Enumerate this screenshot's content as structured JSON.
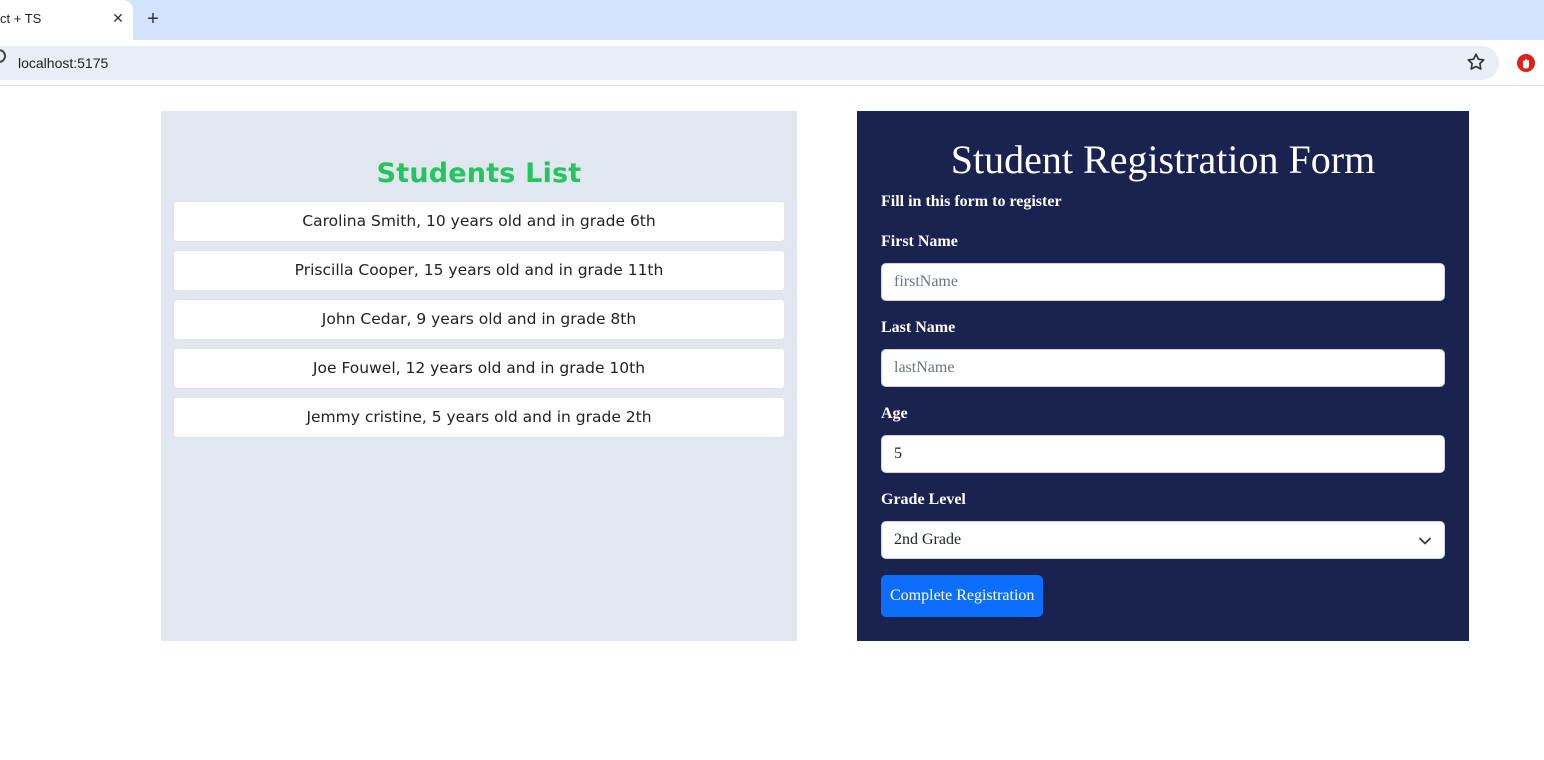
{
  "browser": {
    "tab_title": "ct + TS",
    "url": "localhost:5175"
  },
  "students": {
    "title": "Students List",
    "items": [
      "Carolina Smith, 10 years old and in grade 6th",
      "Priscilla Cooper, 15 years old and in grade 11th",
      "John Cedar, 9 years old and in grade 8th",
      "Joe Fouwel, 12 years old and in grade 10th",
      "Jemmy cristine, 5 years old and in grade 2th"
    ]
  },
  "form": {
    "title": "Student Registration Form",
    "subtitle": "Fill in this form to register",
    "first_name": {
      "label": "First Name",
      "placeholder": "firstName",
      "value": ""
    },
    "last_name": {
      "label": "Last Name",
      "placeholder": "lastName",
      "value": ""
    },
    "age": {
      "label": "Age",
      "value": "5"
    },
    "grade": {
      "label": "Grade Level",
      "selected": "2nd Grade"
    },
    "submit_label": "Complete Registration"
  },
  "colors": {
    "tabstrip": "#d3e3fd",
    "students_title": "#22c55e",
    "left_panel_bg": "#e1e7ef",
    "form_panel_bg": "#1a2350",
    "button_bg": "#0d6efd"
  },
  "icons": {
    "tab_close": "close-icon",
    "new_tab": "plus-icon",
    "bookmark": "star-icon",
    "extension": "extension-icon",
    "select": "chevron-down-icon"
  }
}
